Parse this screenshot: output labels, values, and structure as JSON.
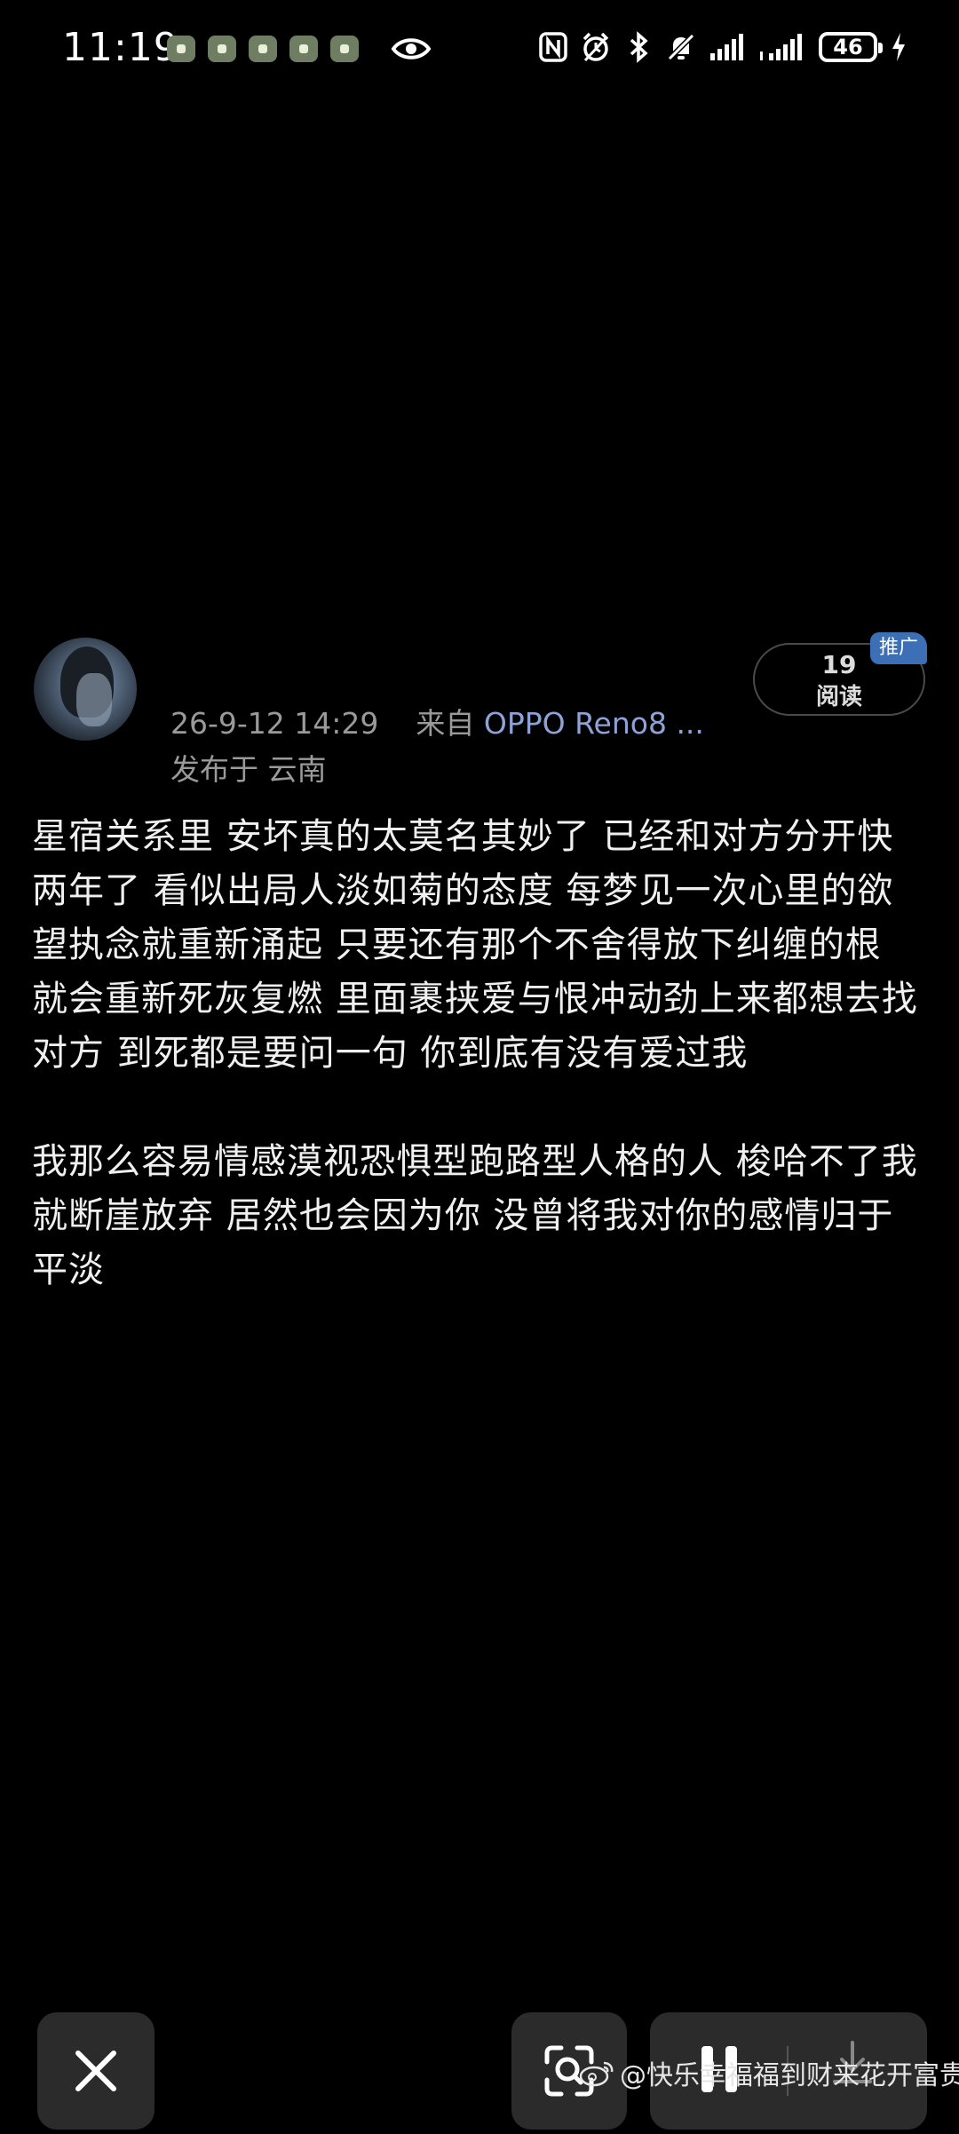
{
  "status_bar": {
    "time": "11:19",
    "battery_level": "46",
    "icons": [
      "notification-icon",
      "notification-icon",
      "notification-icon",
      "notification-icon",
      "notification-icon",
      "eye-icon",
      "nfc-icon",
      "alarm-icon",
      "bluetooth-icon",
      "mute-icon",
      "signal-icon",
      "signal-icon",
      "battery-icon",
      "charging-icon"
    ]
  },
  "post": {
    "timestamp": "26-9-12 14:29",
    "source_prefix": "来自",
    "device": "OPPO Reno8 ...",
    "location": "发布于 云南",
    "read_count": "19",
    "read_label": "阅读",
    "promo_tag": "推广",
    "paragraphs": [
      "星宿关系里 安坏真的太莫名其妙了 已经和对方分开快两年了 看似出局人淡如菊的态度 每梦见一次心里的欲望执念就重新涌起 只要还有那个不舍得放下纠缠的根 就会重新死灰复燃 里面裹挟爱与恨冲动劲上来都想去找对方 到死都是要问一句 你到底有没有爱过我",
      "我那么容易情感漠视恐惧型跑路型人格的人 梭哈不了我就断崖放弃 居然也会因为你 没曾将我对你的感情归于平淡"
    ]
  },
  "controls": {
    "close_icon": "close-icon",
    "scan_icon": "scan-icon",
    "pause_icon": "pause-icon",
    "download_icon": "download-icon"
  },
  "watermark": {
    "text": "@快乐幸福福到财来花开富贵",
    "icon": "weibo-icon"
  }
}
